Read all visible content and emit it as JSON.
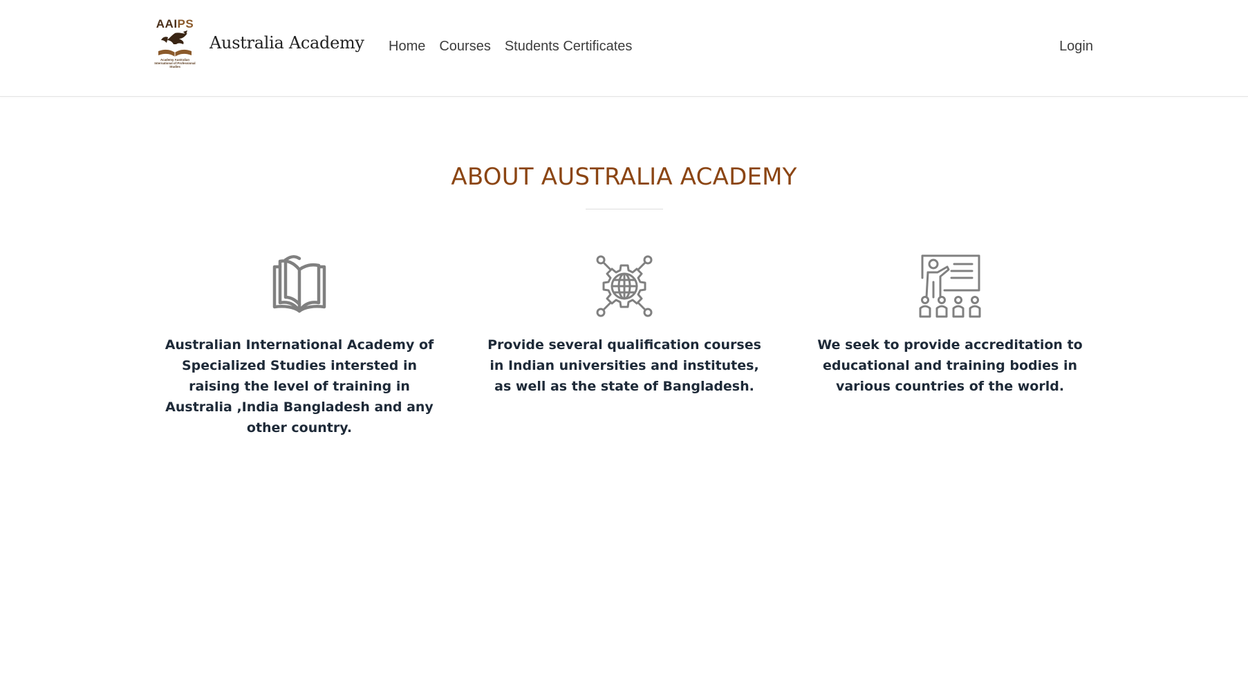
{
  "header": {
    "logo_title_part1": "AAI",
    "logo_title_part2": "PS",
    "logo_subtitle": "Academy Australian International of Professional Studies",
    "brand_name": "Australia Academy",
    "nav": [
      {
        "label": "Home"
      },
      {
        "label": "Courses"
      },
      {
        "label": "Students Certificates"
      }
    ],
    "login_label": "Login"
  },
  "about": {
    "title": "ABOUT AUSTRALIA ACADEMY",
    "features": [
      {
        "icon": "open-book-icon",
        "text": "Australian International Academy of Specialized Studies intersted in raising the level of training in Australia ,India Bangladesh and any other country."
      },
      {
        "icon": "globe-gear-network-icon",
        "text": "Provide several qualification courses in Indian universities and institutes, as well as the state of Bangladesh."
      },
      {
        "icon": "teacher-presentation-icon",
        "text": "We seek to provide accreditation to educational and training bodies in various countries of the world."
      }
    ]
  },
  "colors": {
    "accent": "#8b4513",
    "icon": "#808080",
    "text": "#1e2a38",
    "nav_text": "#3d3d3d",
    "logo_dark": "#4a2f1a",
    "logo_light": "#8b5a2b"
  }
}
